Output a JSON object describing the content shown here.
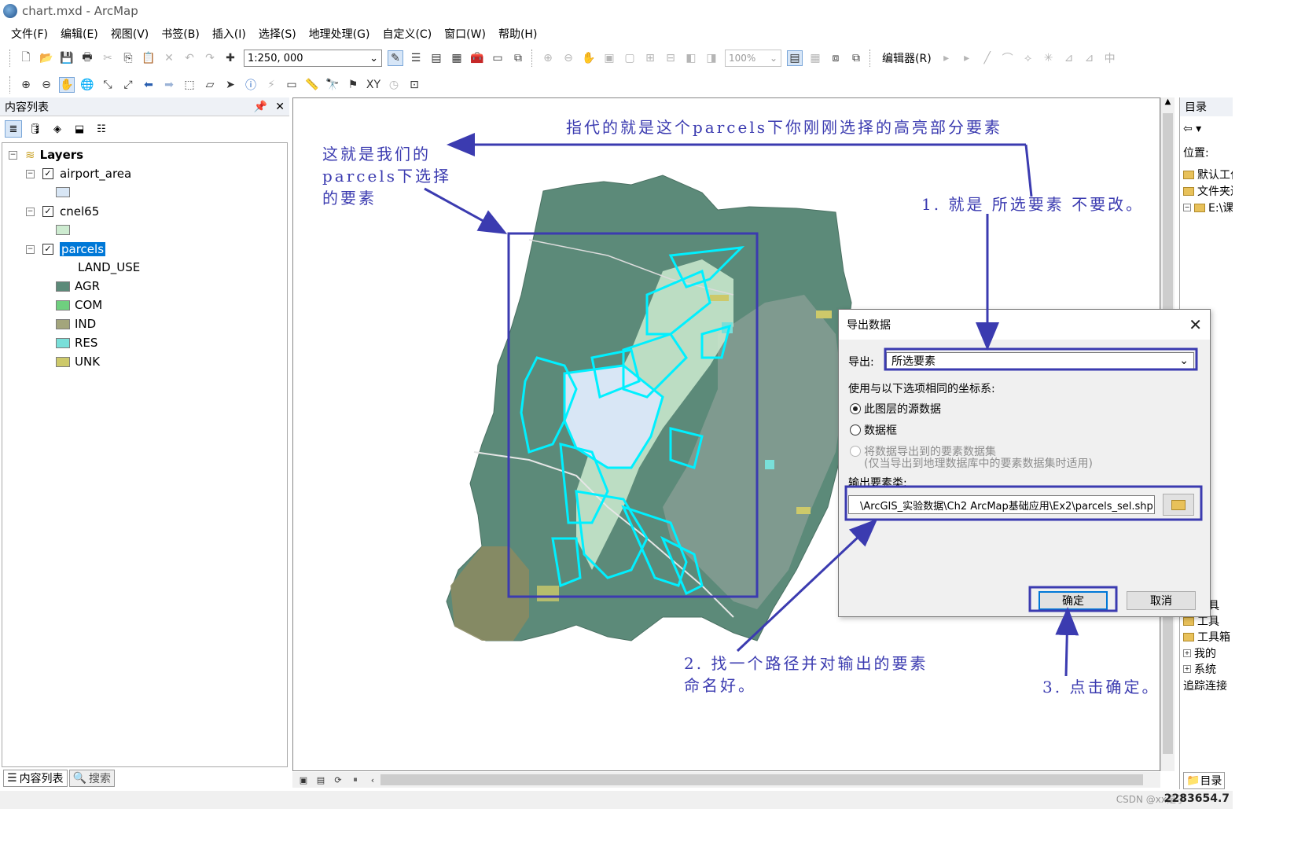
{
  "window": {
    "title": "chart.mxd - ArcMap"
  },
  "menu": [
    "文件(F)",
    "编辑(E)",
    "视图(V)",
    "书签(B)",
    "插入(I)",
    "选择(S)",
    "地理处理(G)",
    "自定义(C)",
    "窗口(W)",
    "帮助(H)"
  ],
  "toolbar": {
    "scale": "1:250, 000",
    "zoom": "100%",
    "editor_label": "编辑器(R)"
  },
  "toc": {
    "title": "内容列表",
    "pin": "⅌",
    "close": "✕",
    "root": "Layers",
    "layers": [
      {
        "name": "airport_area",
        "checked": true,
        "color": "#d8e6f5"
      },
      {
        "name": "cnel65",
        "checked": true,
        "color": "#cdebd0"
      },
      {
        "name": "parcels",
        "checked": true,
        "selected": true,
        "field": "LAND_USE",
        "classes": [
          {
            "label": "AGR",
            "color": "#5c8a79"
          },
          {
            "label": "COM",
            "color": "#6fcf7f"
          },
          {
            "label": "IND",
            "color": "#a3a57c"
          },
          {
            "label": "RES",
            "color": "#79dfd9"
          },
          {
            "label": "UNK",
            "color": "#cdc96a"
          }
        ]
      }
    ],
    "tabs": {
      "toc": "内容列表",
      "search": "搜索"
    }
  },
  "catalog": {
    "title": "目录",
    "location_label": "位置:",
    "rows": [
      "默认工作",
      "文件夹连",
      "E:\\课",
      "工具",
      "工具",
      "工具箱",
      "我的",
      "系统",
      "追踪连接"
    ]
  },
  "dialog": {
    "title": "导出数据",
    "export_label": "导出:",
    "export_value": "所选要素",
    "coord_label": "使用与以下选项相同的坐标系:",
    "option1": "此图层的源数据",
    "option2": "数据框",
    "option3": "将数据导出到的要素数据集",
    "option3_note": "(仅当导出到地理数据库中的要素数据集时适用)",
    "output_label": "输出要素类:",
    "output_path": "\\ArcGIS_实验数据\\Ch2  ArcMap基础应用\\Ex2\\parcels_sel.shp",
    "ok": "确定",
    "cancel": "取消"
  },
  "annotations": {
    "top": "指代的就是这个parcels下你刚刚选择的高亮部分要素",
    "left": "这就是我们的\nparcels下选择\n的要素",
    "step1": "1. 就是  所选要素  不要改。",
    "step2": "2. 找一个路径并对输出的要素\n命名好。",
    "step3": "3. 点击确定。",
    "color": "#3b3bb0"
  },
  "status": {
    "coords": "2283654.7",
    "watermark": "CSDN @xx是子"
  }
}
